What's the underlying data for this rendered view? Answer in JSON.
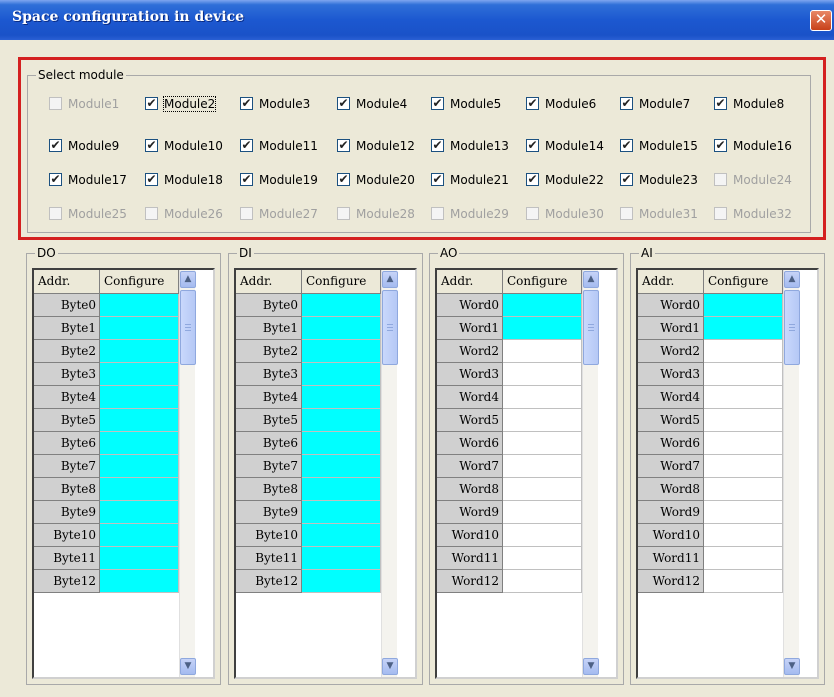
{
  "window": {
    "title": "Space configuration in device",
    "close_glyph": "✕"
  },
  "select_module": {
    "legend": "Select module",
    "modules": [
      {
        "label": "Module1",
        "checked": false,
        "enabled": false
      },
      {
        "label": "Module2",
        "checked": true,
        "enabled": true,
        "focused": true
      },
      {
        "label": "Module3",
        "checked": true,
        "enabled": true
      },
      {
        "label": "Module4",
        "checked": true,
        "enabled": true
      },
      {
        "label": "Module5",
        "checked": true,
        "enabled": true
      },
      {
        "label": "Module6",
        "checked": true,
        "enabled": true
      },
      {
        "label": "Module7",
        "checked": true,
        "enabled": true
      },
      {
        "label": "Module8",
        "checked": true,
        "enabled": true
      },
      {
        "label": "Module9",
        "checked": true,
        "enabled": true
      },
      {
        "label": "Module10",
        "checked": true,
        "enabled": true
      },
      {
        "label": "Module11",
        "checked": true,
        "enabled": true
      },
      {
        "label": "Module12",
        "checked": true,
        "enabled": true
      },
      {
        "label": "Module13",
        "checked": true,
        "enabled": true
      },
      {
        "label": "Module14",
        "checked": true,
        "enabled": true
      },
      {
        "label": "Module15",
        "checked": true,
        "enabled": true
      },
      {
        "label": "Module16",
        "checked": true,
        "enabled": true
      },
      {
        "label": "Module17",
        "checked": true,
        "enabled": true
      },
      {
        "label": "Module18",
        "checked": true,
        "enabled": true
      },
      {
        "label": "Module19",
        "checked": true,
        "enabled": true
      },
      {
        "label": "Module20",
        "checked": true,
        "enabled": true
      },
      {
        "label": "Module21",
        "checked": true,
        "enabled": true
      },
      {
        "label": "Module22",
        "checked": true,
        "enabled": true
      },
      {
        "label": "Module23",
        "checked": true,
        "enabled": true
      },
      {
        "label": "Module24",
        "checked": false,
        "enabled": false
      },
      {
        "label": "Module25",
        "checked": false,
        "enabled": false
      },
      {
        "label": "Module26",
        "checked": false,
        "enabled": false
      },
      {
        "label": "Module27",
        "checked": false,
        "enabled": false
      },
      {
        "label": "Module28",
        "checked": false,
        "enabled": false
      },
      {
        "label": "Module29",
        "checked": false,
        "enabled": false
      },
      {
        "label": "Module30",
        "checked": false,
        "enabled": false
      },
      {
        "label": "Module31",
        "checked": false,
        "enabled": false
      },
      {
        "label": "Module32",
        "checked": false,
        "enabled": false
      }
    ]
  },
  "colors": {
    "configured": "#00ffff",
    "empty": "#ffffff",
    "highlight_border": "#d42020"
  },
  "panels": [
    {
      "id": "do",
      "legend": "DO",
      "addr_header": "Addr.",
      "config_header": "Configure",
      "rows": [
        "Byte0",
        "Byte1",
        "Byte2",
        "Byte3",
        "Byte4",
        "Byte5",
        "Byte6",
        "Byte7",
        "Byte8",
        "Byte9",
        "Byte10",
        "Byte11",
        "Byte12"
      ],
      "configured": [
        true,
        true,
        true,
        true,
        true,
        true,
        true,
        true,
        true,
        true,
        true,
        true,
        true
      ]
    },
    {
      "id": "di",
      "legend": "DI",
      "addr_header": "Addr.",
      "config_header": "Configure",
      "rows": [
        "Byte0",
        "Byte1",
        "Byte2",
        "Byte3",
        "Byte4",
        "Byte5",
        "Byte6",
        "Byte7",
        "Byte8",
        "Byte9",
        "Byte10",
        "Byte11",
        "Byte12"
      ],
      "configured": [
        true,
        true,
        true,
        true,
        true,
        true,
        true,
        true,
        true,
        true,
        true,
        true,
        true
      ]
    },
    {
      "id": "ao",
      "legend": "AO",
      "addr_header": "Addr.",
      "config_header": "Configure",
      "rows": [
        "Word0",
        "Word1",
        "Word2",
        "Word3",
        "Word4",
        "Word5",
        "Word6",
        "Word7",
        "Word8",
        "Word9",
        "Word10",
        "Word11",
        "Word12"
      ],
      "configured": [
        true,
        true,
        false,
        false,
        false,
        false,
        false,
        false,
        false,
        false,
        false,
        false,
        false
      ]
    },
    {
      "id": "ai",
      "legend": "AI",
      "addr_header": "Addr.",
      "config_header": "Configure",
      "rows": [
        "Word0",
        "Word1",
        "Word2",
        "Word3",
        "Word4",
        "Word5",
        "Word6",
        "Word7",
        "Word8",
        "Word9",
        "Word10",
        "Word11",
        "Word12"
      ],
      "configured": [
        true,
        true,
        false,
        false,
        false,
        false,
        false,
        false,
        false,
        false,
        false,
        false,
        false
      ]
    }
  ],
  "scrollbar": {
    "up_glyph": "▲",
    "down_glyph": "▼"
  }
}
